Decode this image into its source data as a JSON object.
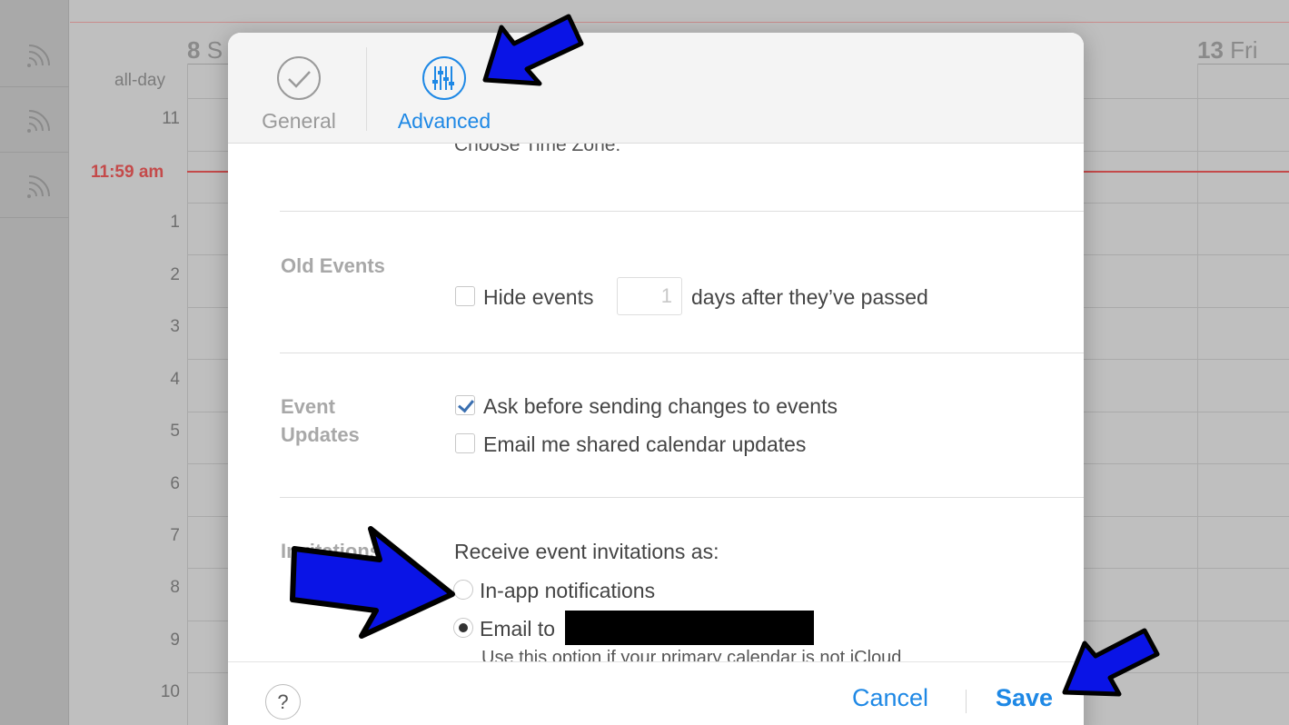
{
  "calendar": {
    "day_left": {
      "num": "8",
      "name": "S"
    },
    "day_right": {
      "num": "13",
      "name": "Fri"
    },
    "allday_label": "all-day",
    "now_label": "11:59 am",
    "hours": [
      "11",
      "1",
      "2",
      "3",
      "4",
      "5",
      "6",
      "7",
      "8",
      "9",
      "10"
    ]
  },
  "dialog": {
    "tabs": [
      {
        "label": "General",
        "icon": "checkmark-circle-icon",
        "selected": false
      },
      {
        "label": "Advanced",
        "icon": "sliders-icon",
        "selected": true
      }
    ],
    "clipped_text": "Choose Time Zone:",
    "old_events": {
      "label": "Old Events",
      "checkbox_label_before": "Hide events",
      "days_value": "1",
      "checkbox_label_after": "days after they’ve passed",
      "checked": false
    },
    "event_updates": {
      "label_line1": "Event",
      "label_line2": "Updates",
      "ask_label": "Ask before sending changes to events",
      "ask_checked": true,
      "email_label": "Email me shared calendar updates",
      "email_checked": false
    },
    "invitations": {
      "label": "Invitations",
      "intro": "Receive event invitations as:",
      "option_inapp": "In-app notifications",
      "option_email": "Email to",
      "selected": "email",
      "hint": "Use this option if your primary calendar is not iCloud"
    },
    "footer": {
      "help": "?",
      "cancel": "Cancel",
      "save": "Save"
    }
  },
  "colors": {
    "accent": "#1e88e5",
    "now_line": "#c44a4a",
    "annotation_arrow": "#0a14e6"
  }
}
